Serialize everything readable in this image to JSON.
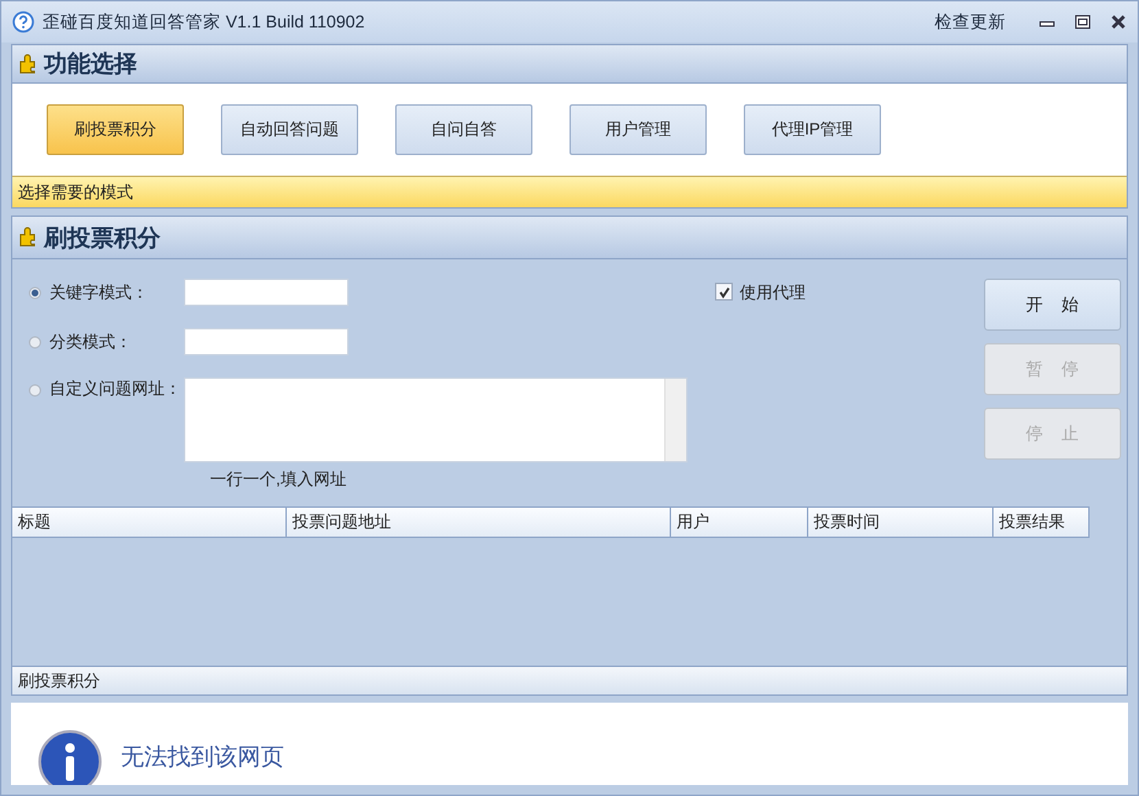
{
  "window": {
    "title": "歪碰百度知道回答管家 V1.1 Build 110902",
    "link": "检查更新"
  },
  "function_panel": {
    "title": "功能选择",
    "buttons": [
      {
        "label": "刷投票积分",
        "selected": true
      },
      {
        "label": "自动回答问题",
        "selected": false
      },
      {
        "label": "自问自答",
        "selected": false
      },
      {
        "label": "用户管理",
        "selected": false
      },
      {
        "label": "代理IP管理",
        "selected": false
      }
    ],
    "hint": "选择需要的模式"
  },
  "vote_panel": {
    "title": "刷投票积分",
    "modes": [
      {
        "label": "关键字模式：",
        "selected": true,
        "kind": "field"
      },
      {
        "label": "分类模式：",
        "selected": false,
        "kind": "field"
      },
      {
        "label": "自定义问题网址：",
        "selected": false,
        "kind": "textarea"
      }
    ],
    "textarea_hint": "一行一个,填入网址",
    "use_proxy": {
      "label": "使用代理",
      "checked": true
    },
    "actions": [
      {
        "label": "开　始",
        "disabled": false
      },
      {
        "label": "暂　停",
        "disabled": true
      },
      {
        "label": "停　止",
        "disabled": true
      }
    ],
    "table": {
      "columns": [
        "标题",
        "投票问题地址",
        "用户",
        "投票时间",
        "投票结果"
      ]
    },
    "footer": "刷投票积分"
  },
  "browser": {
    "message": "无法找到该网页"
  }
}
